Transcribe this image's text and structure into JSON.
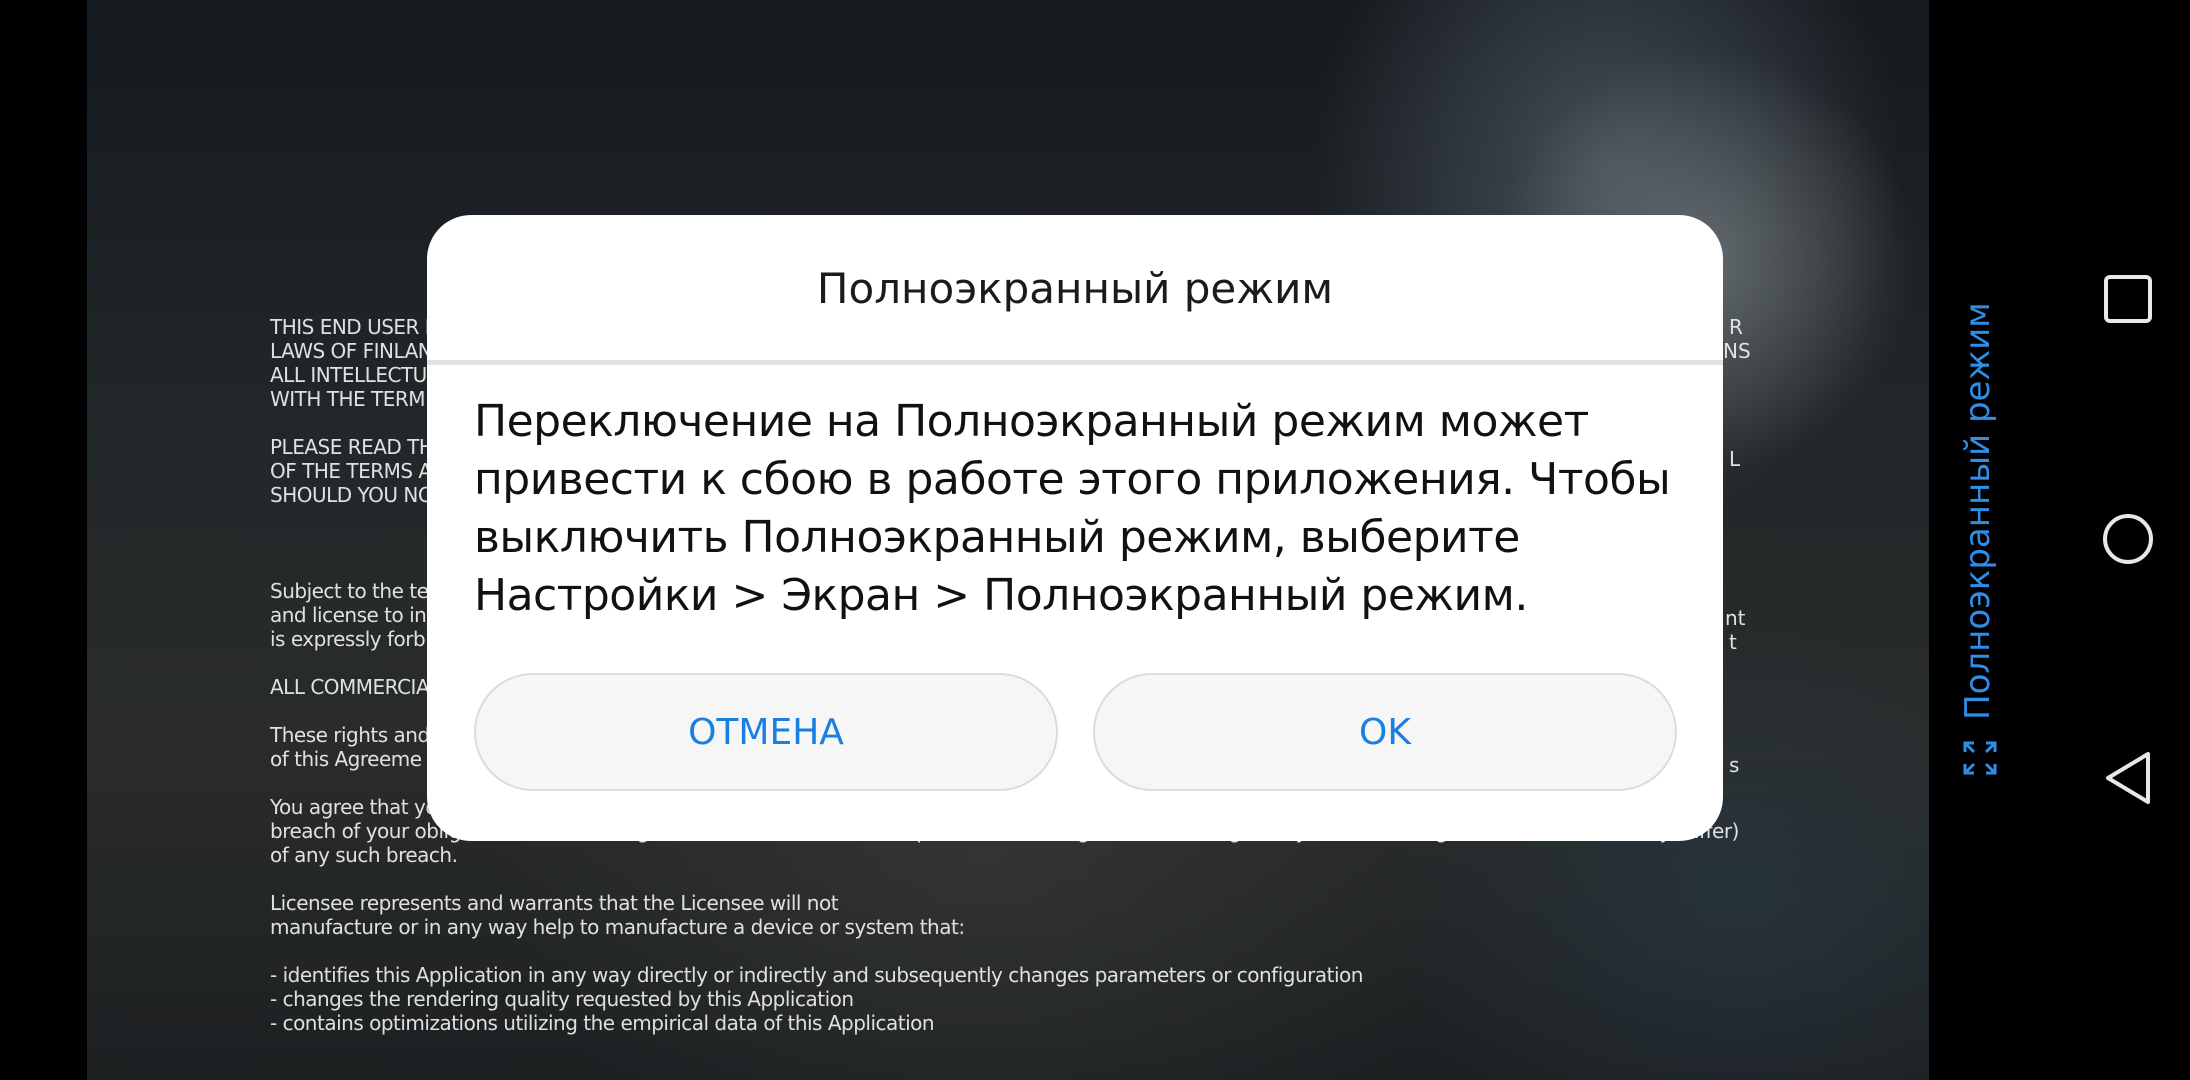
{
  "background_app": {
    "eula_paragraphs": [
      "THIS END USER L\nLAWS OF FINLAN\nALL INTELLECTU\nWITH THE TERM",
      "PLEASE READ TH\nOF THE TERMS A\nSHOULD YOU NO",
      "",
      "Subject to the te\nand license to ins\nis expressly forb",
      "ALL COMMERCIA",
      "These rights and\nof this Agreeme",
      "You agree that you are solely responsible for (and that Basemark has no responsibility to you or to any third party for) your use of the Application, any\nbreach of your obligations under the Agreement, and for the consequences (including but not limiting to any loss or damage which Basemark may suffer)\nof any such breach.",
      "Licensee represents and warrants that the Licensee will not\nmanufacture or in any way help to manufacture a device or system that:",
      "- identifies this Application in any way directly or indirectly and subsequently changes parameters or configuration\n- changes the rendering quality requested by this Application\n- contains optimizations utilizing the empirical data of this Application"
    ],
    "right_fragments": [
      "R",
      "NS",
      "",
      "L",
      "",
      "nt",
      "t",
      "",
      "s"
    ]
  },
  "dialog": {
    "title": "Полноэкранный режим",
    "message": "Переключение на Полноэкранный режим может привести к сбою в работе этого приложения. Чтобы выключить Полноэкранный режим, выберите Настройки > Экран > Полноэкранный режим.",
    "cancel_label": "ОТМЕНА",
    "ok_label": "OK"
  },
  "side_panel": {
    "fullscreen_label": "Полноэкранный режим",
    "fullscreen_icon": "fullscreen-icon"
  },
  "navigation_bar": {
    "recents_icon": "square-icon",
    "home_icon": "circle-icon",
    "back_icon": "triangle-back-icon"
  },
  "colors": {
    "accent": "#1a7fe0",
    "side_label": "#2f8fe6",
    "dialog_bg": "#ffffff",
    "button_bg": "#f6f6f6"
  }
}
